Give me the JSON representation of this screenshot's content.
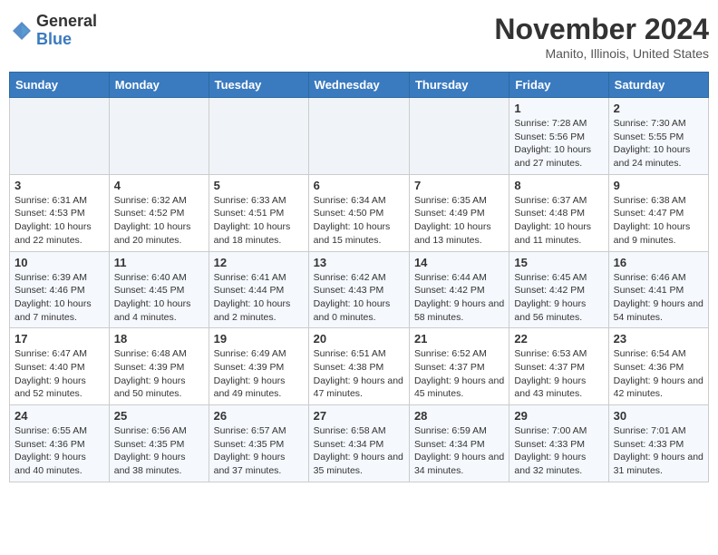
{
  "header": {
    "logo_line1": "General",
    "logo_line2": "Blue",
    "month": "November 2024",
    "location": "Manito, Illinois, United States"
  },
  "weekdays": [
    "Sunday",
    "Monday",
    "Tuesday",
    "Wednesday",
    "Thursday",
    "Friday",
    "Saturday"
  ],
  "weeks": [
    [
      {
        "day": "",
        "info": ""
      },
      {
        "day": "",
        "info": ""
      },
      {
        "day": "",
        "info": ""
      },
      {
        "day": "",
        "info": ""
      },
      {
        "day": "",
        "info": ""
      },
      {
        "day": "1",
        "info": "Sunrise: 7:28 AM\nSunset: 5:56 PM\nDaylight: 10 hours and 27 minutes."
      },
      {
        "day": "2",
        "info": "Sunrise: 7:30 AM\nSunset: 5:55 PM\nDaylight: 10 hours and 24 minutes."
      }
    ],
    [
      {
        "day": "3",
        "info": "Sunrise: 6:31 AM\nSunset: 4:53 PM\nDaylight: 10 hours and 22 minutes."
      },
      {
        "day": "4",
        "info": "Sunrise: 6:32 AM\nSunset: 4:52 PM\nDaylight: 10 hours and 20 minutes."
      },
      {
        "day": "5",
        "info": "Sunrise: 6:33 AM\nSunset: 4:51 PM\nDaylight: 10 hours and 18 minutes."
      },
      {
        "day": "6",
        "info": "Sunrise: 6:34 AM\nSunset: 4:50 PM\nDaylight: 10 hours and 15 minutes."
      },
      {
        "day": "7",
        "info": "Sunrise: 6:35 AM\nSunset: 4:49 PM\nDaylight: 10 hours and 13 minutes."
      },
      {
        "day": "8",
        "info": "Sunrise: 6:37 AM\nSunset: 4:48 PM\nDaylight: 10 hours and 11 minutes."
      },
      {
        "day": "9",
        "info": "Sunrise: 6:38 AM\nSunset: 4:47 PM\nDaylight: 10 hours and 9 minutes."
      }
    ],
    [
      {
        "day": "10",
        "info": "Sunrise: 6:39 AM\nSunset: 4:46 PM\nDaylight: 10 hours and 7 minutes."
      },
      {
        "day": "11",
        "info": "Sunrise: 6:40 AM\nSunset: 4:45 PM\nDaylight: 10 hours and 4 minutes."
      },
      {
        "day": "12",
        "info": "Sunrise: 6:41 AM\nSunset: 4:44 PM\nDaylight: 10 hours and 2 minutes."
      },
      {
        "day": "13",
        "info": "Sunrise: 6:42 AM\nSunset: 4:43 PM\nDaylight: 10 hours and 0 minutes."
      },
      {
        "day": "14",
        "info": "Sunrise: 6:44 AM\nSunset: 4:42 PM\nDaylight: 9 hours and 58 minutes."
      },
      {
        "day": "15",
        "info": "Sunrise: 6:45 AM\nSunset: 4:42 PM\nDaylight: 9 hours and 56 minutes."
      },
      {
        "day": "16",
        "info": "Sunrise: 6:46 AM\nSunset: 4:41 PM\nDaylight: 9 hours and 54 minutes."
      }
    ],
    [
      {
        "day": "17",
        "info": "Sunrise: 6:47 AM\nSunset: 4:40 PM\nDaylight: 9 hours and 52 minutes."
      },
      {
        "day": "18",
        "info": "Sunrise: 6:48 AM\nSunset: 4:39 PM\nDaylight: 9 hours and 50 minutes."
      },
      {
        "day": "19",
        "info": "Sunrise: 6:49 AM\nSunset: 4:39 PM\nDaylight: 9 hours and 49 minutes."
      },
      {
        "day": "20",
        "info": "Sunrise: 6:51 AM\nSunset: 4:38 PM\nDaylight: 9 hours and 47 minutes."
      },
      {
        "day": "21",
        "info": "Sunrise: 6:52 AM\nSunset: 4:37 PM\nDaylight: 9 hours and 45 minutes."
      },
      {
        "day": "22",
        "info": "Sunrise: 6:53 AM\nSunset: 4:37 PM\nDaylight: 9 hours and 43 minutes."
      },
      {
        "day": "23",
        "info": "Sunrise: 6:54 AM\nSunset: 4:36 PM\nDaylight: 9 hours and 42 minutes."
      }
    ],
    [
      {
        "day": "24",
        "info": "Sunrise: 6:55 AM\nSunset: 4:36 PM\nDaylight: 9 hours and 40 minutes."
      },
      {
        "day": "25",
        "info": "Sunrise: 6:56 AM\nSunset: 4:35 PM\nDaylight: 9 hours and 38 minutes."
      },
      {
        "day": "26",
        "info": "Sunrise: 6:57 AM\nSunset: 4:35 PM\nDaylight: 9 hours and 37 minutes."
      },
      {
        "day": "27",
        "info": "Sunrise: 6:58 AM\nSunset: 4:34 PM\nDaylight: 9 hours and 35 minutes."
      },
      {
        "day": "28",
        "info": "Sunrise: 6:59 AM\nSunset: 4:34 PM\nDaylight: 9 hours and 34 minutes."
      },
      {
        "day": "29",
        "info": "Sunrise: 7:00 AM\nSunset: 4:33 PM\nDaylight: 9 hours and 32 minutes."
      },
      {
        "day": "30",
        "info": "Sunrise: 7:01 AM\nSunset: 4:33 PM\nDaylight: 9 hours and 31 minutes."
      }
    ]
  ]
}
